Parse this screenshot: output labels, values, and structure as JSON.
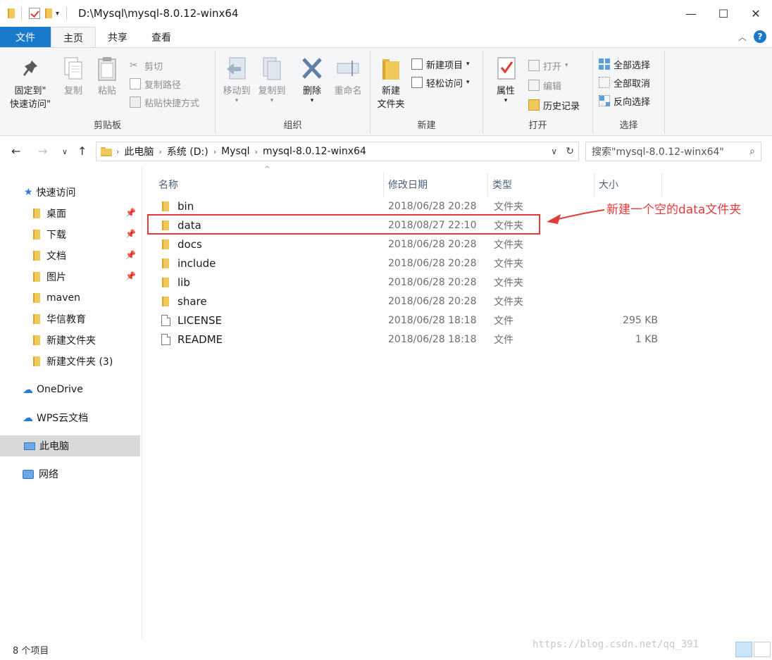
{
  "window": {
    "title": "D:\\Mysql\\mysql-8.0.12-winx64",
    "minimize": "—",
    "maximize": "☐",
    "close": "✕"
  },
  "tabs": [
    {
      "label": "文件"
    },
    {
      "label": "主页"
    },
    {
      "label": "共享"
    },
    {
      "label": "查看"
    }
  ],
  "ribbon": {
    "clipboard": {
      "label": "剪贴板",
      "pin_line1": "固定到\"",
      "pin_line2": "快速访问\"",
      "copy": "复制",
      "paste": "粘贴",
      "cut": "剪切",
      "copy_path": "复制路径",
      "paste_shortcut": "粘贴快捷方式"
    },
    "organize": {
      "label": "组织",
      "move_to": "移动到",
      "copy_to": "复制到",
      "delete": "删除",
      "rename": "重命名"
    },
    "new": {
      "label": "新建",
      "new_folder_line1": "新建",
      "new_folder_line2": "文件夹",
      "new_item": "新建项目",
      "easy_access": "轻松访问"
    },
    "open": {
      "label": "打开",
      "properties": "属性",
      "open": "打开",
      "edit": "编辑",
      "history": "历史记录"
    },
    "select": {
      "label": "选择",
      "select_all": "全部选择",
      "select_none": "全部取消",
      "invert": "反向选择"
    }
  },
  "address": {
    "crumbs": [
      "此电脑",
      "系统 (D:)",
      "Mysql",
      "mysql-8.0.12-winx64"
    ],
    "search_placeholder": "搜索\"mysql-8.0.12-winx64\""
  },
  "sidebar": {
    "items": [
      {
        "label": "快速访问"
      },
      {
        "label": "桌面"
      },
      {
        "label": "下载"
      },
      {
        "label": "文档"
      },
      {
        "label": "图片"
      },
      {
        "label": "maven"
      },
      {
        "label": "华信教育"
      },
      {
        "label": "新建文件夹"
      },
      {
        "label": "新建文件夹 (3)"
      },
      {
        "label": "OneDrive"
      },
      {
        "label": "WPS云文档"
      },
      {
        "label": "此电脑"
      },
      {
        "label": "网络"
      }
    ]
  },
  "columns": {
    "name": "名称",
    "date": "修改日期",
    "type": "类型",
    "size": "大小"
  },
  "files": [
    {
      "name": "bin",
      "date": "2018/06/28 20:28",
      "type": "文件夹",
      "size": ""
    },
    {
      "name": "data",
      "date": "2018/08/27 22:10",
      "type": "文件夹",
      "size": ""
    },
    {
      "name": "docs",
      "date": "2018/06/28 20:28",
      "type": "文件夹",
      "size": ""
    },
    {
      "name": "include",
      "date": "2018/06/28 20:28",
      "type": "文件夹",
      "size": ""
    },
    {
      "name": "lib",
      "date": "2018/06/28 20:28",
      "type": "文件夹",
      "size": ""
    },
    {
      "name": "share",
      "date": "2018/06/28 20:28",
      "type": "文件夹",
      "size": ""
    },
    {
      "name": "LICENSE",
      "date": "2018/06/28 18:18",
      "type": "文件",
      "size": "295 KB"
    },
    {
      "name": "README",
      "date": "2018/06/28 18:18",
      "type": "文件",
      "size": "1 KB"
    }
  ],
  "annotation": {
    "text": "新建一个空的data文件夹",
    "color": "#e53a3a"
  },
  "status": {
    "item_count": "8 个项目"
  },
  "watermark": "https://blog.csdn.net/qq_391"
}
